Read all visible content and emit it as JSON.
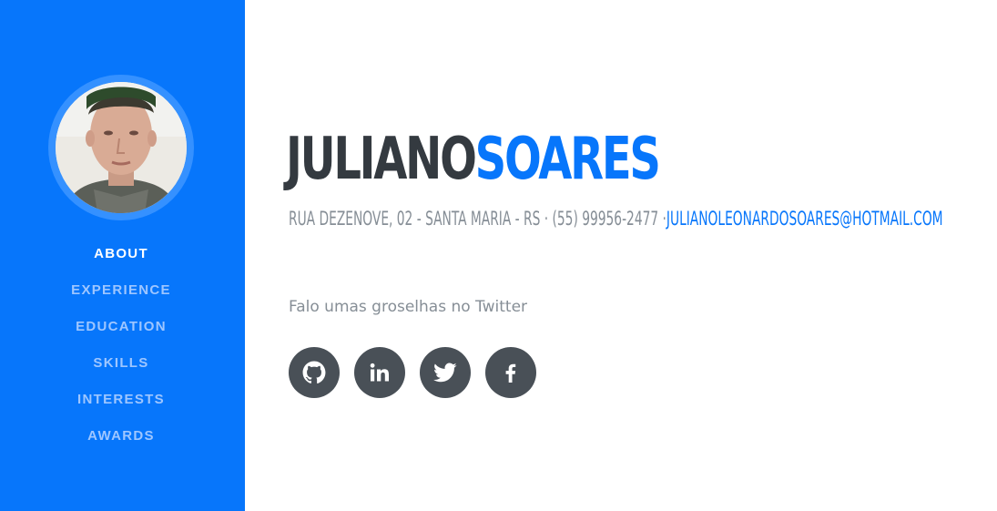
{
  "sidebar": {
    "avatar_alt": "Profile photo",
    "nav": [
      {
        "label": "ABOUT",
        "active": true
      },
      {
        "label": "EXPERIENCE",
        "active": false
      },
      {
        "label": "EDUCATION",
        "active": false
      },
      {
        "label": "SKILLS",
        "active": false
      },
      {
        "label": "INTERESTS",
        "active": false
      },
      {
        "label": "AWARDS",
        "active": false
      }
    ]
  },
  "about": {
    "first_name": "JULIANO",
    "last_name": "SOARES",
    "address": "RUA DEZENOVE, 02 - SANTA MARIA - RS · (55) 99956-2477 ·",
    "email": "JULIANOLEONARDOSOARES@HOTMAIL.COM",
    "bio": "Falo umas groselhas no Twitter",
    "social": [
      {
        "icon": "github-icon"
      },
      {
        "icon": "linkedin-icon"
      },
      {
        "icon": "twitter-icon"
      },
      {
        "icon": "facebook-icon"
      }
    ]
  },
  "colors": {
    "primary": "#0776fb",
    "dark": "#343a40",
    "muted": "#868e96",
    "social_bg": "#495057"
  }
}
